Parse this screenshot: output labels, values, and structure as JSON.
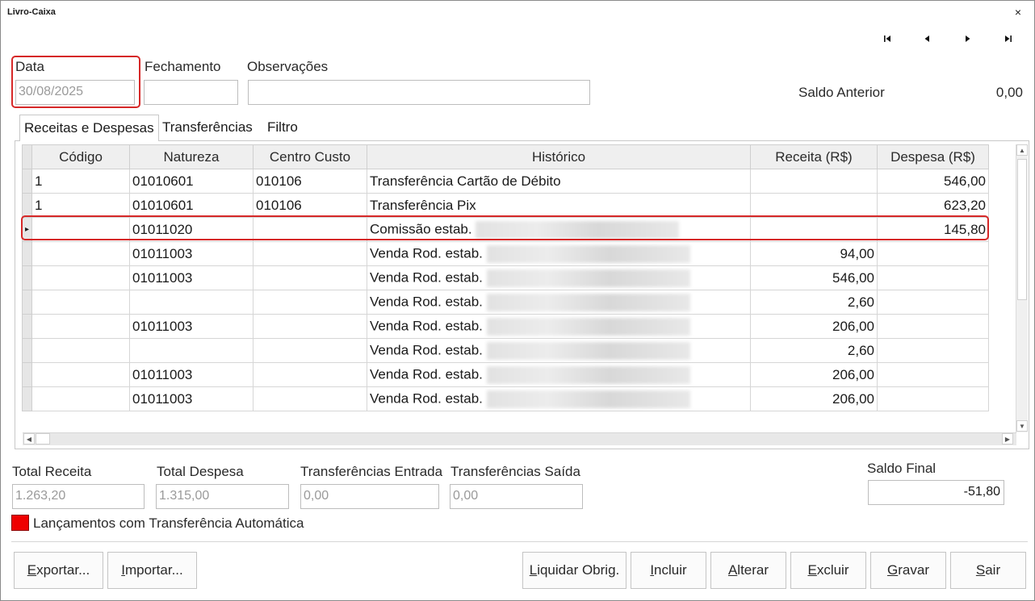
{
  "window": {
    "title": "Livro-Caixa",
    "close_glyph": "×"
  },
  "nav": {
    "first_icon": "first-record-icon",
    "prev_icon": "previous-record-icon",
    "next_icon": "next-record-icon",
    "last_icon": "last-record-icon"
  },
  "header": {
    "data_label": "Data",
    "data_value": "30/08/2025",
    "fechamento_label": "Fechamento",
    "fechamento_value": "",
    "observacoes_label": "Observações",
    "observacoes_value": "",
    "saldo_anterior_label": "Saldo Anterior",
    "saldo_anterior_value": "0,00"
  },
  "tabs": [
    {
      "label": "Receitas e Despesas",
      "active": true
    },
    {
      "label": "Transferências",
      "active": false
    },
    {
      "label": "Filtro",
      "active": false
    }
  ],
  "grid": {
    "columns": [
      "Código",
      "Natureza",
      "Centro Custo",
      "Histórico",
      "Receita (R$)",
      "Despesa (R$)"
    ],
    "rows": [
      {
        "indicator": "",
        "codigo": "1",
        "natureza": "01010601",
        "centro": "010106",
        "historico": "Transferência Cartão de Débito",
        "receita": "",
        "despesa": "546,00"
      },
      {
        "indicator": "",
        "codigo": "1",
        "natureza": "01010601",
        "centro": "010106",
        "historico": "Transferência Pix",
        "receita": "",
        "despesa": "623,20"
      },
      {
        "indicator": "▸",
        "codigo": "",
        "natureza": "01011020",
        "centro": "",
        "historico": "Comissão estab.",
        "receita": "",
        "despesa": "145,80"
      },
      {
        "indicator": "",
        "codigo": "",
        "natureza": "01011003",
        "centro": "",
        "historico": "Venda Rod. estab.",
        "receita": "94,00",
        "despesa": ""
      },
      {
        "indicator": "",
        "codigo": "",
        "natureza": "01011003",
        "centro": "",
        "historico": "Venda Rod. estab.",
        "receita": "546,00",
        "despesa": ""
      },
      {
        "indicator": "",
        "codigo": "",
        "natureza": "",
        "centro": "",
        "historico": "Venda Rod. estab.",
        "receita": "2,60",
        "despesa": ""
      },
      {
        "indicator": "",
        "codigo": "",
        "natureza": "01011003",
        "centro": "",
        "historico": "Venda Rod. estab.",
        "receita": "206,00",
        "despesa": ""
      },
      {
        "indicator": "",
        "codigo": "",
        "natureza": "",
        "centro": "",
        "historico": "Venda Rod. estab.",
        "receita": "2,60",
        "despesa": ""
      },
      {
        "indicator": "",
        "codigo": "",
        "natureza": "01011003",
        "centro": "",
        "historico": "Venda Rod. estab.",
        "receita": "206,00",
        "despesa": ""
      },
      {
        "indicator": "",
        "codigo": "",
        "natureza": "01011003",
        "centro": "",
        "historico": "Venda Rod. estab.",
        "receita": "206,00",
        "despesa": ""
      }
    ]
  },
  "totals": {
    "total_receita_label": "Total Receita",
    "total_receita_value": "1.263,20",
    "total_despesa_label": "Total Despesa",
    "total_despesa_value": "1.315,00",
    "transf_entrada_label": "Transferências Entrada",
    "transf_entrada_value": "0,00",
    "transf_saida_label": "Transferências Saída",
    "transf_saida_value": "0,00",
    "saldo_final_label": "Saldo Final",
    "saldo_final_value": "-51,80"
  },
  "legend": {
    "label": "Lançamentos com Transferência Automática",
    "color": "#ee0000"
  },
  "buttons": {
    "exportar": {
      "u": "E",
      "rest": "xportar..."
    },
    "importar": {
      "u": "I",
      "rest": "mportar..."
    },
    "liquidar": {
      "u": "L",
      "rest": "iquidar Obrig."
    },
    "incluir": {
      "u": "I",
      "rest": "ncluir"
    },
    "alterar": {
      "u": "A",
      "rest": "lterar"
    },
    "excluir": {
      "u": "E",
      "rest": "xcluir"
    },
    "gravar": {
      "u": "G",
      "rest": "ravar"
    },
    "sair": {
      "u": "S",
      "rest": "air"
    }
  },
  "colors": {
    "highlight": "#d62828"
  }
}
